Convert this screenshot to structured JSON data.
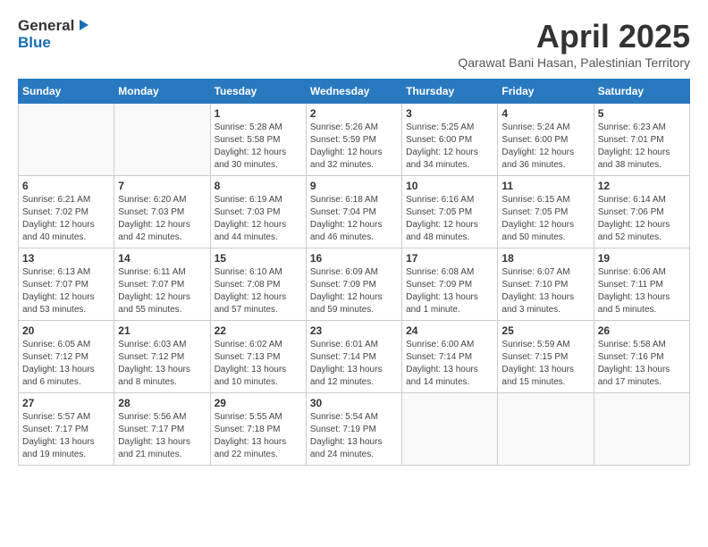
{
  "header": {
    "logo_general": "General",
    "logo_blue": "Blue",
    "month_year": "April 2025",
    "location": "Qarawat Bani Hasan, Palestinian Territory"
  },
  "calendar": {
    "days_of_week": [
      "Sunday",
      "Monday",
      "Tuesday",
      "Wednesday",
      "Thursday",
      "Friday",
      "Saturday"
    ],
    "weeks": [
      [
        {
          "day": "",
          "details": ""
        },
        {
          "day": "",
          "details": ""
        },
        {
          "day": "1",
          "details": "Sunrise: 5:28 AM\nSunset: 5:58 PM\nDaylight: 12 hours\nand 30 minutes."
        },
        {
          "day": "2",
          "details": "Sunrise: 5:26 AM\nSunset: 5:59 PM\nDaylight: 12 hours\nand 32 minutes."
        },
        {
          "day": "3",
          "details": "Sunrise: 5:25 AM\nSunset: 6:00 PM\nDaylight: 12 hours\nand 34 minutes."
        },
        {
          "day": "4",
          "details": "Sunrise: 5:24 AM\nSunset: 6:00 PM\nDaylight: 12 hours\nand 36 minutes."
        },
        {
          "day": "5",
          "details": "Sunrise: 6:23 AM\nSunset: 7:01 PM\nDaylight: 12 hours\nand 38 minutes."
        }
      ],
      [
        {
          "day": "6",
          "details": "Sunrise: 6:21 AM\nSunset: 7:02 PM\nDaylight: 12 hours\nand 40 minutes."
        },
        {
          "day": "7",
          "details": "Sunrise: 6:20 AM\nSunset: 7:03 PM\nDaylight: 12 hours\nand 42 minutes."
        },
        {
          "day": "8",
          "details": "Sunrise: 6:19 AM\nSunset: 7:03 PM\nDaylight: 12 hours\nand 44 minutes."
        },
        {
          "day": "9",
          "details": "Sunrise: 6:18 AM\nSunset: 7:04 PM\nDaylight: 12 hours\nand 46 minutes."
        },
        {
          "day": "10",
          "details": "Sunrise: 6:16 AM\nSunset: 7:05 PM\nDaylight: 12 hours\nand 48 minutes."
        },
        {
          "day": "11",
          "details": "Sunrise: 6:15 AM\nSunset: 7:05 PM\nDaylight: 12 hours\nand 50 minutes."
        },
        {
          "day": "12",
          "details": "Sunrise: 6:14 AM\nSunset: 7:06 PM\nDaylight: 12 hours\nand 52 minutes."
        }
      ],
      [
        {
          "day": "13",
          "details": "Sunrise: 6:13 AM\nSunset: 7:07 PM\nDaylight: 12 hours\nand 53 minutes."
        },
        {
          "day": "14",
          "details": "Sunrise: 6:11 AM\nSunset: 7:07 PM\nDaylight: 12 hours\nand 55 minutes."
        },
        {
          "day": "15",
          "details": "Sunrise: 6:10 AM\nSunset: 7:08 PM\nDaylight: 12 hours\nand 57 minutes."
        },
        {
          "day": "16",
          "details": "Sunrise: 6:09 AM\nSunset: 7:09 PM\nDaylight: 12 hours\nand 59 minutes."
        },
        {
          "day": "17",
          "details": "Sunrise: 6:08 AM\nSunset: 7:09 PM\nDaylight: 13 hours\nand 1 minute."
        },
        {
          "day": "18",
          "details": "Sunrise: 6:07 AM\nSunset: 7:10 PM\nDaylight: 13 hours\nand 3 minutes."
        },
        {
          "day": "19",
          "details": "Sunrise: 6:06 AM\nSunset: 7:11 PM\nDaylight: 13 hours\nand 5 minutes."
        }
      ],
      [
        {
          "day": "20",
          "details": "Sunrise: 6:05 AM\nSunset: 7:12 PM\nDaylight: 13 hours\nand 6 minutes."
        },
        {
          "day": "21",
          "details": "Sunrise: 6:03 AM\nSunset: 7:12 PM\nDaylight: 13 hours\nand 8 minutes."
        },
        {
          "day": "22",
          "details": "Sunrise: 6:02 AM\nSunset: 7:13 PM\nDaylight: 13 hours\nand 10 minutes."
        },
        {
          "day": "23",
          "details": "Sunrise: 6:01 AM\nSunset: 7:14 PM\nDaylight: 13 hours\nand 12 minutes."
        },
        {
          "day": "24",
          "details": "Sunrise: 6:00 AM\nSunset: 7:14 PM\nDaylight: 13 hours\nand 14 minutes."
        },
        {
          "day": "25",
          "details": "Sunrise: 5:59 AM\nSunset: 7:15 PM\nDaylight: 13 hours\nand 15 minutes."
        },
        {
          "day": "26",
          "details": "Sunrise: 5:58 AM\nSunset: 7:16 PM\nDaylight: 13 hours\nand 17 minutes."
        }
      ],
      [
        {
          "day": "27",
          "details": "Sunrise: 5:57 AM\nSunset: 7:17 PM\nDaylight: 13 hours\nand 19 minutes."
        },
        {
          "day": "28",
          "details": "Sunrise: 5:56 AM\nSunset: 7:17 PM\nDaylight: 13 hours\nand 21 minutes."
        },
        {
          "day": "29",
          "details": "Sunrise: 5:55 AM\nSunset: 7:18 PM\nDaylight: 13 hours\nand 22 minutes."
        },
        {
          "day": "30",
          "details": "Sunrise: 5:54 AM\nSunset: 7:19 PM\nDaylight: 13 hours\nand 24 minutes."
        },
        {
          "day": "",
          "details": ""
        },
        {
          "day": "",
          "details": ""
        },
        {
          "day": "",
          "details": ""
        }
      ]
    ]
  }
}
